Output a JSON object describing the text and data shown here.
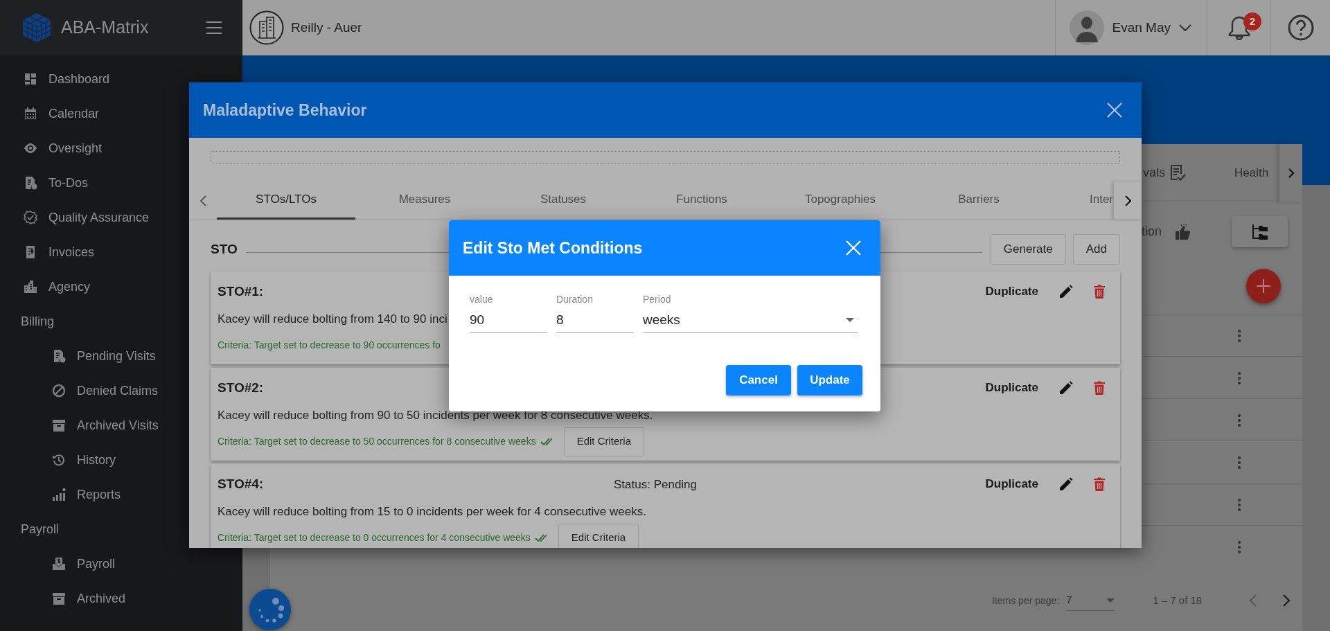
{
  "app": {
    "name": "ABA-Matrix"
  },
  "sidebar": {
    "items": [
      {
        "label": "Dashboard"
      },
      {
        "label": "Calendar"
      },
      {
        "label": "Oversight"
      },
      {
        "label": "To-Dos"
      },
      {
        "label": "Quality Assurance"
      },
      {
        "label": "Invoices"
      },
      {
        "label": "Agency"
      }
    ],
    "sections": [
      {
        "title": "Billing",
        "items": [
          {
            "label": "Pending Visits"
          },
          {
            "label": "Denied Claims"
          },
          {
            "label": "Archived Visits"
          },
          {
            "label": "History"
          },
          {
            "label": "Reports"
          }
        ]
      },
      {
        "title": "Payroll",
        "items": [
          {
            "label": "Payroll"
          },
          {
            "label": "Archived"
          }
        ]
      }
    ]
  },
  "header": {
    "organization": "Reilly - Auer",
    "user": "Evan May",
    "notifications": "2"
  },
  "background": {
    "tabs": [
      "vals",
      "Health"
    ],
    "subtitle": "tion",
    "pagination": {
      "label": "Items per page:",
      "value": "7",
      "range": "1 – 7 of 18"
    }
  },
  "modal": {
    "title": "Maladaptive Behavior",
    "tabs": [
      {
        "label": "STOs/LTOs",
        "selected": true
      },
      {
        "label": "Measures",
        "selected": false
      },
      {
        "label": "Statuses",
        "selected": false
      },
      {
        "label": "Functions",
        "selected": false
      },
      {
        "label": "Topographies",
        "selected": false
      },
      {
        "label": "Barriers",
        "selected": false
      },
      {
        "label": "Inter",
        "selected": false
      }
    ],
    "section_title": "STO",
    "actions": [
      "Generate",
      "Add"
    ],
    "stos": [
      {
        "title": "STO#1:",
        "text": "Kacey will reduce bolting from 140 to 90 inci",
        "criteria": "Criteria: Target set to decrease to 90 occurrences fo",
        "duplicate": "Duplicate"
      },
      {
        "title": "STO#2:",
        "text": "Kacey will reduce bolting from 90 to 50 incidents per week for 8 consecutive weeks.",
        "criteria": "Criteria: Target set to decrease to 50 occurrences for 8 consecutive weeks",
        "edit": "Edit Criteria",
        "duplicate": "Duplicate"
      },
      {
        "title": "STO#4:",
        "status": "Status: Pending",
        "text": "Kacey will reduce bolting from 15 to 0 incidents per week for 4 consecutive weeks.",
        "criteria": "Criteria: Target set to decrease to 0 occurrences for 4 consecutive weeks",
        "edit": "Edit Criteria",
        "duplicate": "Duplicate"
      }
    ]
  },
  "dialog": {
    "title": "Edit Sto Met Conditions",
    "fields": [
      {
        "kind": "text",
        "label": "value",
        "value": "90"
      },
      {
        "kind": "text",
        "label": "Duration",
        "value": "8"
      },
      {
        "kind": "select",
        "label": "Period",
        "value": "weeks"
      }
    ],
    "buttons": [
      "Cancel",
      "Update"
    ]
  }
}
